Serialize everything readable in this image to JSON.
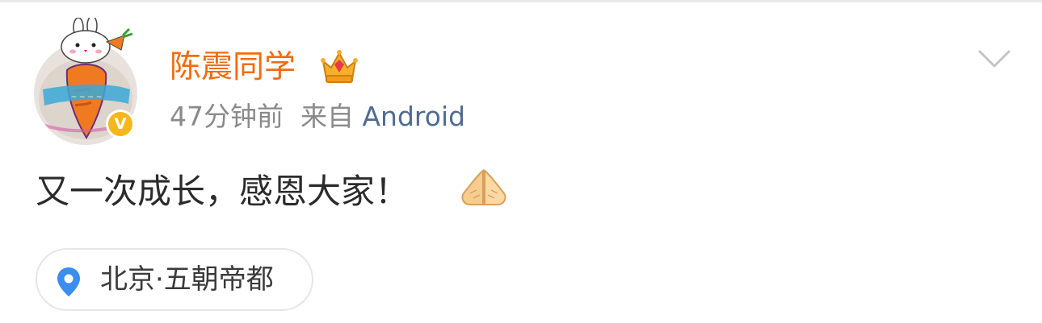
{
  "post": {
    "author": {
      "name": "陈震同学",
      "verified_mark": "V",
      "name_color": "#f26c0e",
      "badge_icon": "crown-icon"
    },
    "time_ago": "47分钟前",
    "source_prefix": "来自",
    "source": "Android",
    "text": "又一次成长，感恩大家！",
    "emoji_icon": "praying-hands-icon",
    "location": {
      "label": "北京·五朝帝都",
      "icon": "location-pin-icon"
    },
    "menu_icon": "chevron-down-icon"
  },
  "colors": {
    "meta": "#8a8a8a",
    "source_link": "#516b91",
    "verified_badge": "#f5b81a",
    "pin": "#3b8df0"
  }
}
